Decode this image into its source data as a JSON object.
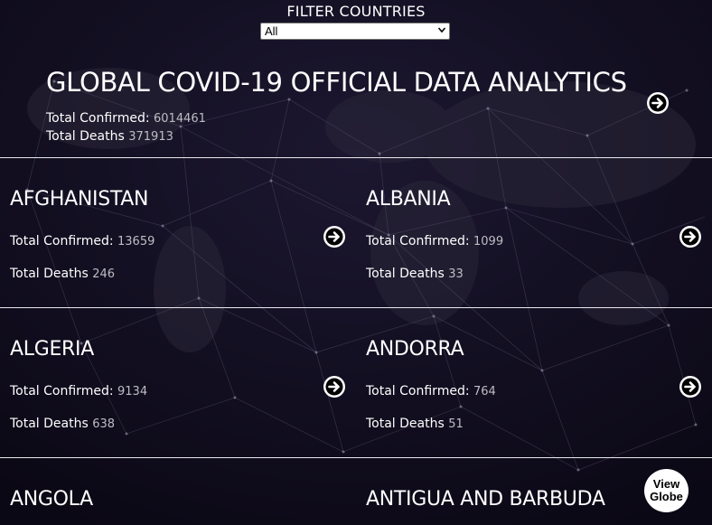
{
  "filter": {
    "title": "FILTER COUNTRIES",
    "selected": "All"
  },
  "global": {
    "title": "GLOBAL COVID-19 OFFICIAL DATA ANALYTICS",
    "confirmed_label": "Total Confirmed:",
    "confirmed_value": "6014461",
    "deaths_label": "Total Deaths",
    "deaths_value": "371913"
  },
  "countries": [
    {
      "name": "AFGHANISTAN",
      "confirmed_label": "Total Confirmed:",
      "confirmed": "13659",
      "deaths_label": "Total Deaths",
      "deaths": "246"
    },
    {
      "name": "ALBANIA",
      "confirmed_label": "Total Confirmed:",
      "confirmed": "1099",
      "deaths_label": "Total Deaths",
      "deaths": "33"
    },
    {
      "name": "ALGERIA",
      "confirmed_label": "Total Confirmed:",
      "confirmed": "9134",
      "deaths_label": "Total Deaths",
      "deaths": "638"
    },
    {
      "name": "ANDORRA",
      "confirmed_label": "Total Confirmed:",
      "confirmed": "764",
      "deaths_label": "Total Deaths",
      "deaths": "51"
    },
    {
      "name": "ANGOLA"
    },
    {
      "name": "ANTIGUA AND BARBUDA"
    }
  ],
  "view_globe": {
    "line1": "View",
    "line2": "Globe"
  },
  "icons": {
    "detail": "arrow-circle-right-icon",
    "select": "chevron-down-icon"
  },
  "colors": {
    "background": "#0e0b19",
    "text": "#ffffff",
    "muted_value": "#bdbdc4",
    "divider": "#e8e8ee"
  }
}
